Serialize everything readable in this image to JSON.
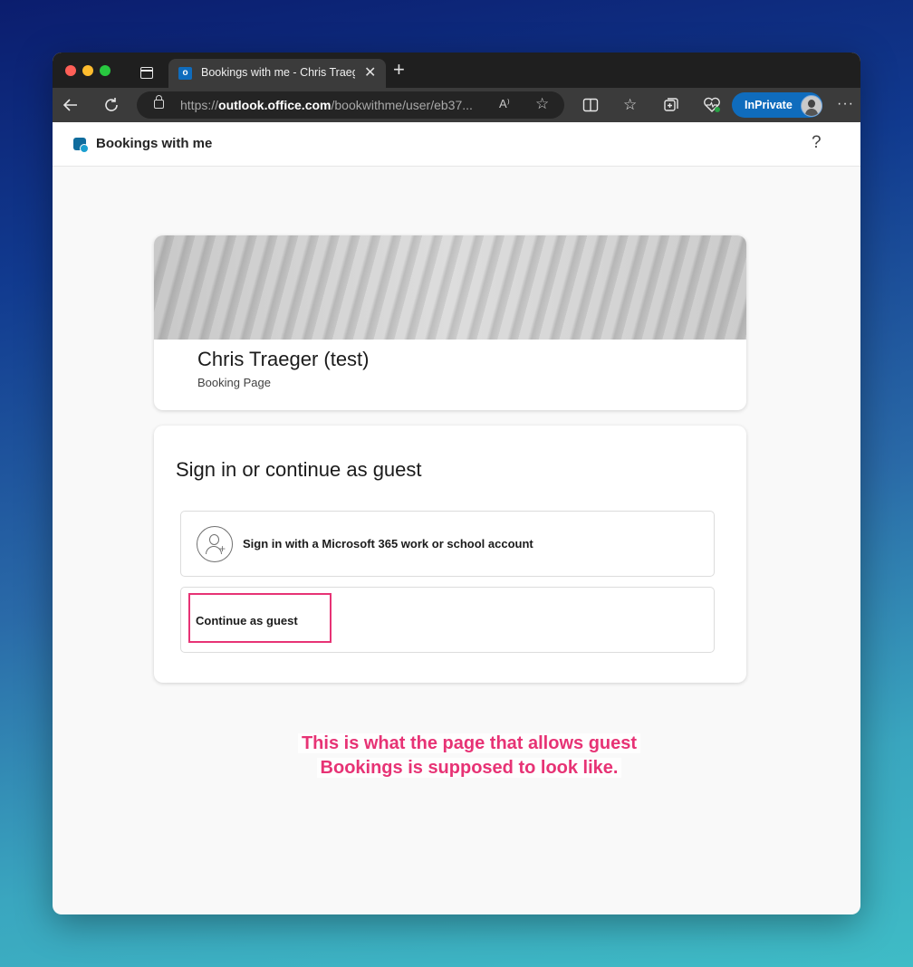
{
  "browser": {
    "tab_title": "Bookings with me - Chris Traeger (test)",
    "tab_favicon_letter": "o",
    "tab_close": "✕",
    "new_tab": "+",
    "url_prefix": "https://",
    "url_domain": "outlook.office.com",
    "url_path": "/bookwithme/user/eb37...",
    "read_aloud": "A⁾",
    "inprivate_label": "InPrivate",
    "more": "···",
    "icons": [
      "back-icon",
      "refresh-icon",
      "lock-icon",
      "read-aloud-icon",
      "favorite-star-icon",
      "split-screen-icon",
      "favorites-icon",
      "collections-icon",
      "browser-essentials-icon",
      "profile-avatar-icon",
      "more-icon"
    ]
  },
  "app": {
    "title": "Bookings with me",
    "help": "?"
  },
  "profile": {
    "name": "Chris Traeger (test)",
    "subtitle": "Booking Page"
  },
  "signin": {
    "heading": "Sign in or continue as guest",
    "microsoft_option": "Sign in with a Microsoft 365 work or school account",
    "guest_option": "Continue as guest"
  },
  "annotation": {
    "line1": "This is what the page that allows guest",
    "line2": "Bookings is supposed to look like.",
    "color": "#e73375"
  }
}
